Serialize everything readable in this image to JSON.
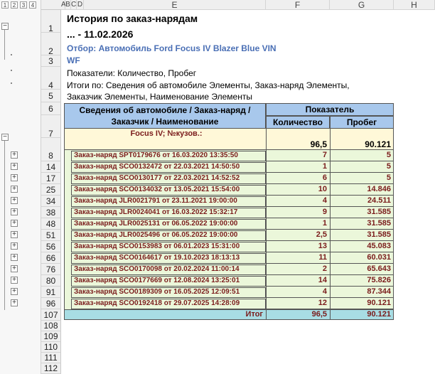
{
  "outline_levels": [
    "1",
    "2",
    "3",
    "4"
  ],
  "columns": [
    "A",
    "B",
    "C",
    "D",
    "E",
    "F",
    "G",
    "H"
  ],
  "title": "История по заказ-нарядам",
  "period": "... - 11.02.2026",
  "filter_line1": "Отбор: Автомобиль Ford Focus IV Blazer Blue VIN",
  "filter_line2": "WF",
  "indicators": "Показатели: Количество, Пробег",
  "totals_line1": "Итоги по: Сведения об автомобиле Элементы, Заказ-наряд Элементы,",
  "totals_line2": "Заказчик Элементы, Наименование Элементы",
  "table": {
    "group_header_line1": "Сведения об автомобиле / Заказ-наряд /",
    "group_header_line2": "Заказчик / Наименование",
    "indicator_header": "Показатель",
    "qty_header": "Количество",
    "mileage_header": "Пробег",
    "car_label": "Focus IV; №кузов.:",
    "car_qty": "96,5",
    "car_mileage": "90.121",
    "orders": [
      {
        "row": "8",
        "name": "Заказ-наряд SPT0179676 от 16.03.2020 13:35:50",
        "qty": "7",
        "mileage": "5"
      },
      {
        "row": "14",
        "name": "Заказ-наряд SCO0132472 от 22.03.2021 14:50:50",
        "qty": "1",
        "mileage": "5"
      },
      {
        "row": "17",
        "name": "Заказ-наряд SCO0130177 от 22.03.2021 14:52:52",
        "qty": "6",
        "mileage": "5"
      },
      {
        "row": "25",
        "name": "Заказ-наряд SCO0134032 от 13.05.2021 15:54:00",
        "qty": "10",
        "mileage": "14.846"
      },
      {
        "row": "34",
        "name": "Заказ-наряд JLR0021791 от 23.11.2021 19:00:00",
        "qty": "4",
        "mileage": "24.511"
      },
      {
        "row": "38",
        "name": "Заказ-наряд JLR0024041 от 16.03.2022 15:32:17",
        "qty": "9",
        "mileage": "31.585"
      },
      {
        "row": "48",
        "name": "Заказ-наряд JLR0025131 от 06.05.2022 19:00:00",
        "qty": "1",
        "mileage": "31.585"
      },
      {
        "row": "51",
        "name": "Заказ-наряд JLR0025496 от 06.05.2022 19:00:00",
        "qty": "2,5",
        "mileage": "31.585"
      },
      {
        "row": "56",
        "name": "Заказ-наряд SCO0153983 от 06.01.2023 15:31:00",
        "qty": "13",
        "mileage": "45.083"
      },
      {
        "row": "66",
        "name": "Заказ-наряд SCO0164617 от 19.10.2023 18:13:13",
        "qty": "11",
        "mileage": "60.031"
      },
      {
        "row": "76",
        "name": "Заказ-наряд SCO0170098 от 20.02.2024 11:00:14",
        "qty": "2",
        "mileage": "65.643"
      },
      {
        "row": "80",
        "name": "Заказ-наряд SCO0177669 от 12.08.2024 13:25:01",
        "qty": "14",
        "mileage": "75.826"
      },
      {
        "row": "91",
        "name": "Заказ-наряд SCO0189309 от 16.05.2025 12:09:51",
        "qty": "4",
        "mileage": "87.344"
      },
      {
        "row": "96",
        "name": "Заказ-наряд SCO0192418 от 29.07.2025 14:28:09",
        "qty": "12",
        "mileage": "90.121"
      }
    ],
    "total_label": "Итог",
    "total_qty": "96,5",
    "total_mileage": "90.121"
  },
  "row_numbers": {
    "r1": "1",
    "r2": "2",
    "r3": "3",
    "r4": "4",
    "r5": "5",
    "r6": "6",
    "r7": "7",
    "r107": "107",
    "r108": "108",
    "r109": "109",
    "r110": "110",
    "r111": "111",
    "r112": "112"
  },
  "icons": {
    "collapse": "minus-box-icon",
    "expand": "plus-box-icon"
  }
}
